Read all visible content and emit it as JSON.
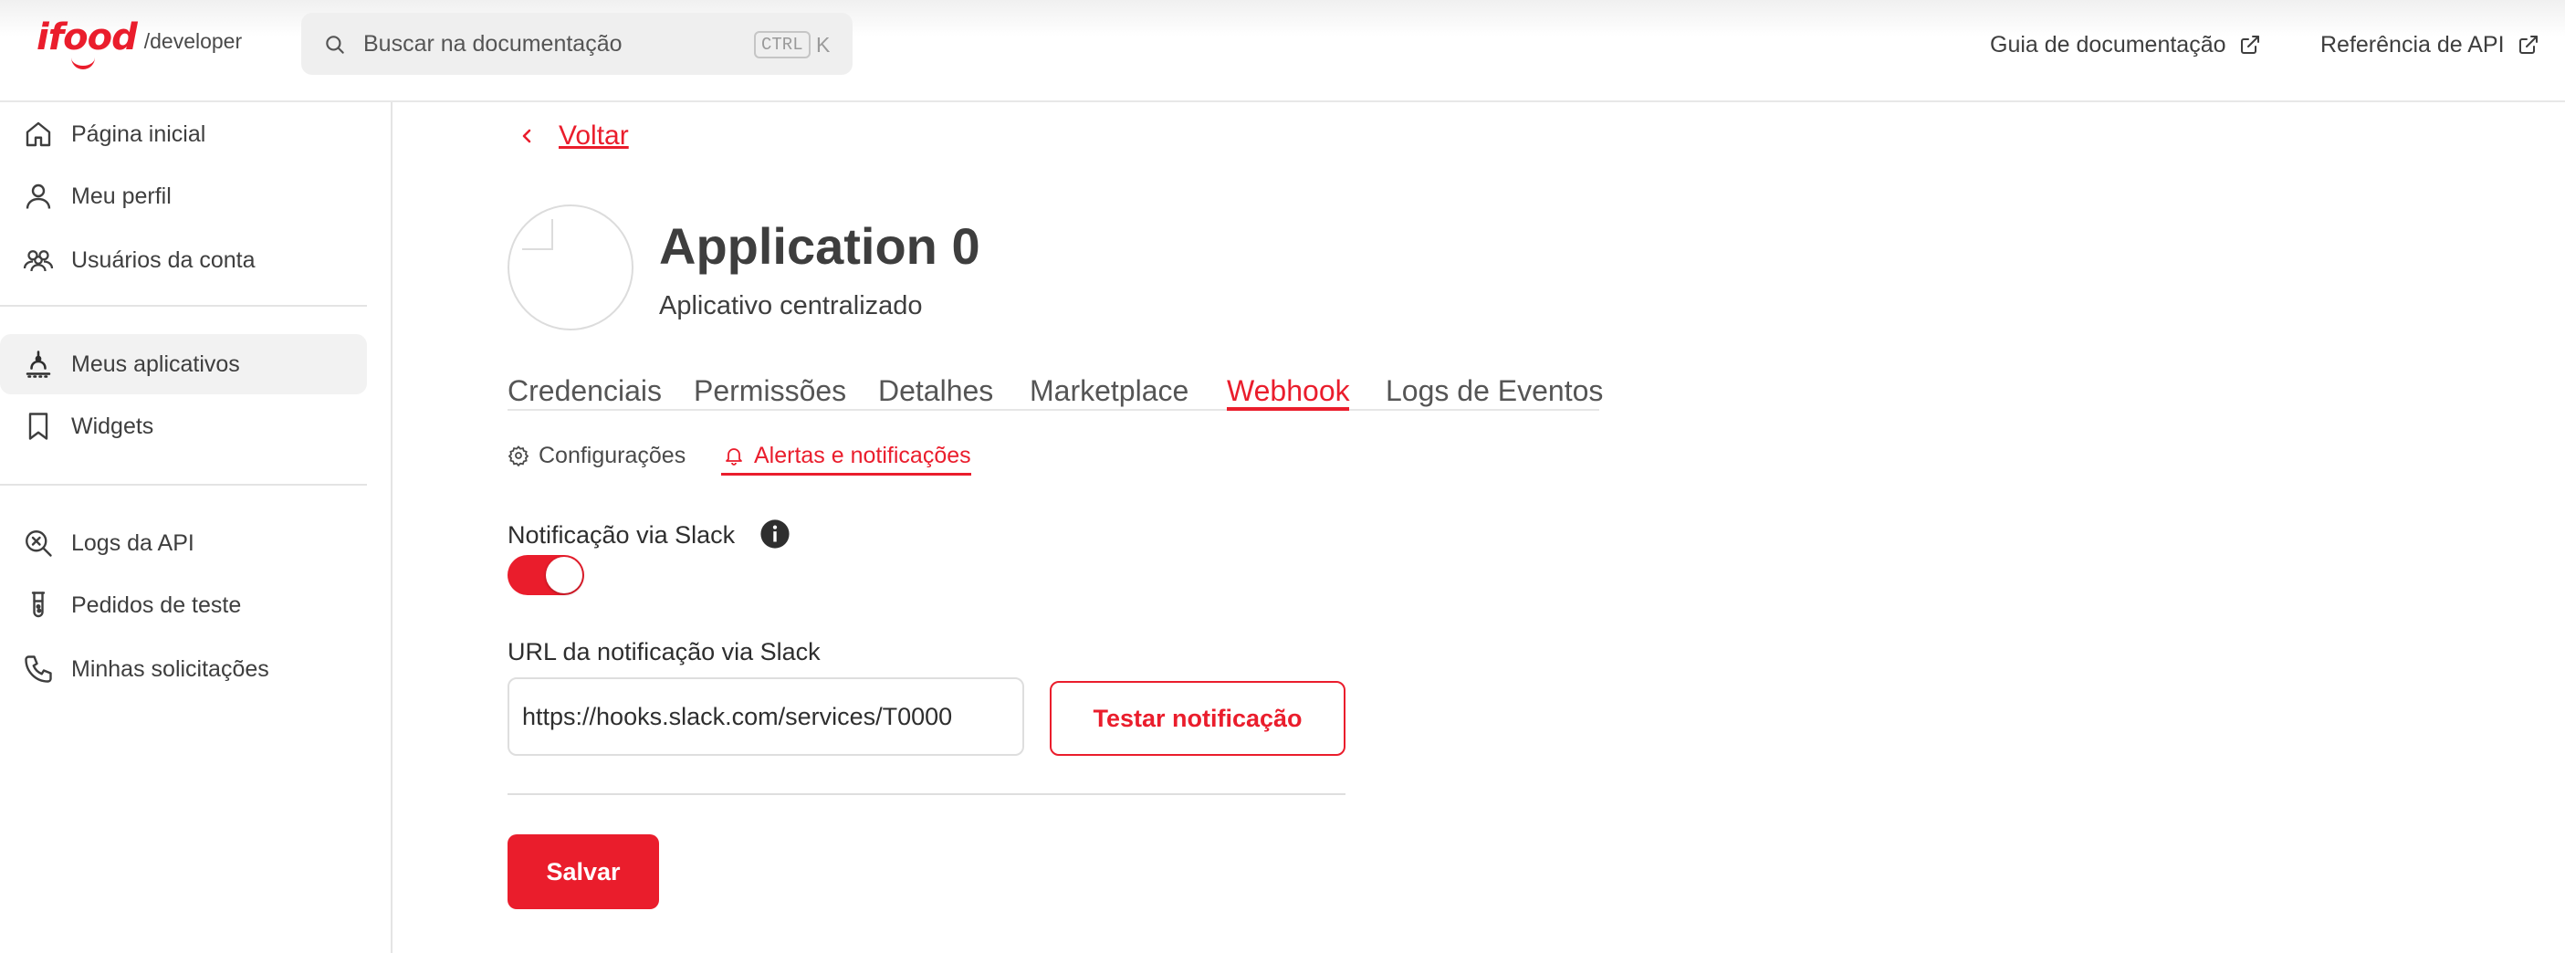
{
  "colors": {
    "brand": "#ea1d2c",
    "text": "#3e3e3e",
    "active_bg": "#f2f2f2"
  },
  "header": {
    "logo_word": "ifood",
    "logo_sub": "/developer",
    "search": {
      "placeholder": "Buscar na documentação",
      "shortcut_ctrl": "CTRL",
      "shortcut_key": "K"
    },
    "links": [
      {
        "label": "Guia de documentação",
        "icon": "external-link-icon"
      },
      {
        "label": "Referência de API",
        "icon": "external-link-icon"
      }
    ]
  },
  "sidebar": {
    "items": [
      {
        "label": "Página inicial",
        "icon": "home-icon"
      },
      {
        "label": "Meu perfil",
        "icon": "user-icon"
      },
      {
        "label": "Usuários da conta",
        "icon": "users-icon"
      },
      {
        "label": "Meus aplicativos",
        "icon": "apps-icon",
        "active": true
      },
      {
        "label": "Widgets",
        "icon": "bookmark-icon"
      },
      {
        "label": "Logs da API",
        "icon": "logs-search-icon"
      },
      {
        "label": "Pedidos de teste",
        "icon": "test-tube-icon"
      },
      {
        "label": "Minhas solicitações",
        "icon": "phone-icon"
      }
    ]
  },
  "main": {
    "back_label": "Voltar",
    "app": {
      "title": "Application 0",
      "subtitle": "Aplicativo centralizado"
    },
    "tabs": [
      {
        "label": "Credenciais"
      },
      {
        "label": "Permissões"
      },
      {
        "label": "Detalhes"
      },
      {
        "label": "Marketplace"
      },
      {
        "label": "Webhook",
        "active": true
      },
      {
        "label": "Logs de Eventos"
      }
    ],
    "subtabs": [
      {
        "label": "Configurações",
        "icon": "gear-icon"
      },
      {
        "label": "Alertas e notificações",
        "icon": "bell-icon",
        "active": true
      }
    ],
    "slack_toggle": {
      "label": "Notificação via Slack",
      "enabled": true
    },
    "slack_url": {
      "label": "URL da notificação via Slack",
      "value": "https://hooks.slack.com/services/T0000"
    },
    "test_button": "Testar notificação",
    "save_button": "Salvar"
  }
}
